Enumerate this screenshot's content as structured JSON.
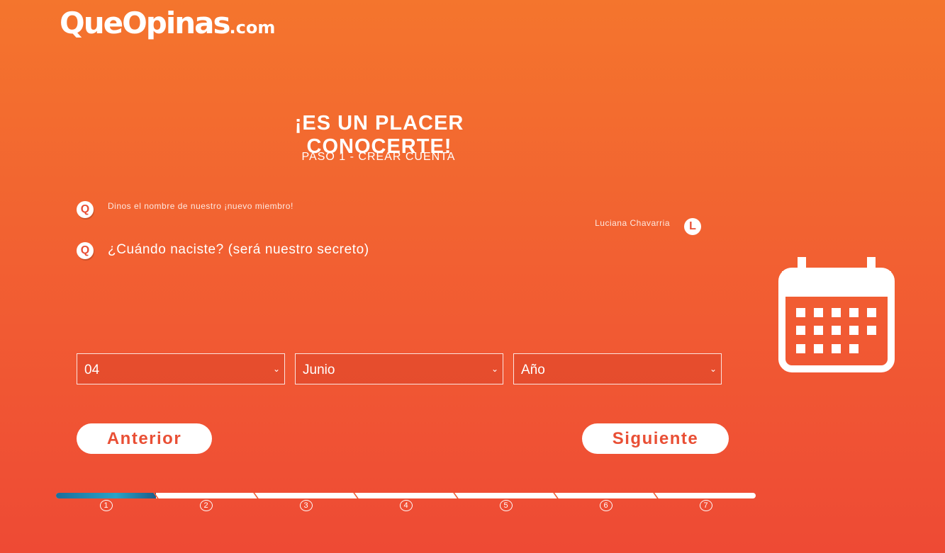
{
  "brand": {
    "name": "QueOpinas",
    "tld": ".com"
  },
  "header": {
    "title": "¡ES UN PLACER CONOCERTE!",
    "subtitle": "PASO 1 - CREAR CUENTA"
  },
  "chat": {
    "bot_initial": "Q",
    "bot_message_1": "Dinos el nombre de nuestro ¡nuevo miembro!",
    "user_name": "Luciana Chavarria",
    "user_initial": "L",
    "bot_question": "¿Cuándo naciste? (será nuestro secreto)"
  },
  "birthdate": {
    "day": "04",
    "month": "Junio",
    "year": "Año"
  },
  "buttons": {
    "prev": "Anterior",
    "next": "Siguiente"
  },
  "progress": {
    "current_step": 1,
    "total_steps": 7,
    "steps": [
      "1",
      "2",
      "3",
      "4",
      "5",
      "6",
      "7"
    ]
  },
  "icons": {
    "calendar": "calendar-icon",
    "select_arrow": "chevron-down-icon"
  },
  "colors": {
    "brand": "#f15a33",
    "progress": "#29a3c6"
  }
}
